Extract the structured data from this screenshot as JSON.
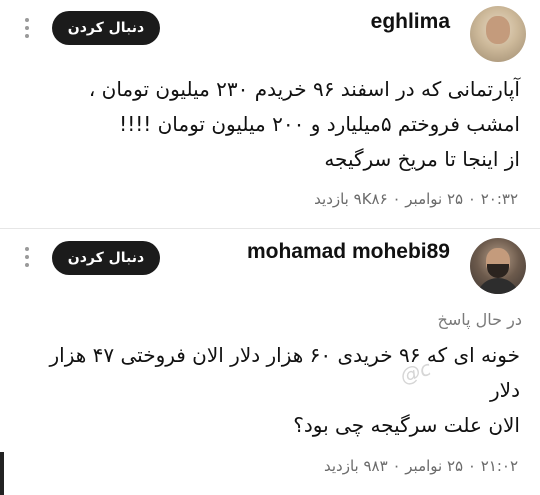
{
  "posts": [
    {
      "username": "eghlima",
      "follow_label": "دنبال کردن",
      "text_lines": [
        "آپارتمانی که در اسفند ۹۶ خریدم ۲۳۰ میلیون تومان ،",
        "امشب فروختم ۵میلیارد و ۲۰۰ میلیون تومان !!!!",
        "از اینجا تا مریخ سرگیجه"
      ],
      "meta": "۲۰:۳۲ ۰ ۲۵ نوامبر ۰ ۹K۸۶ بازدید"
    },
    {
      "username": "mohamad mohebi89",
      "follow_label": "دنبال کردن",
      "reply_status": "در حال پاسخ",
      "text_lines": [
        "خونه ای که ۹۶ خریدی ۶۰ هزار دلار الان فروختی ۴۷ هزار",
        "دلار",
        "الان علت سرگیجه چی بود؟"
      ],
      "meta": "۲۱:۰۲ ۰ ۲۵ نوامبر ۰ ۹۸۳ بازدید"
    }
  ],
  "icons": {
    "more": "more-vertical-icon",
    "avatar": "avatar"
  }
}
